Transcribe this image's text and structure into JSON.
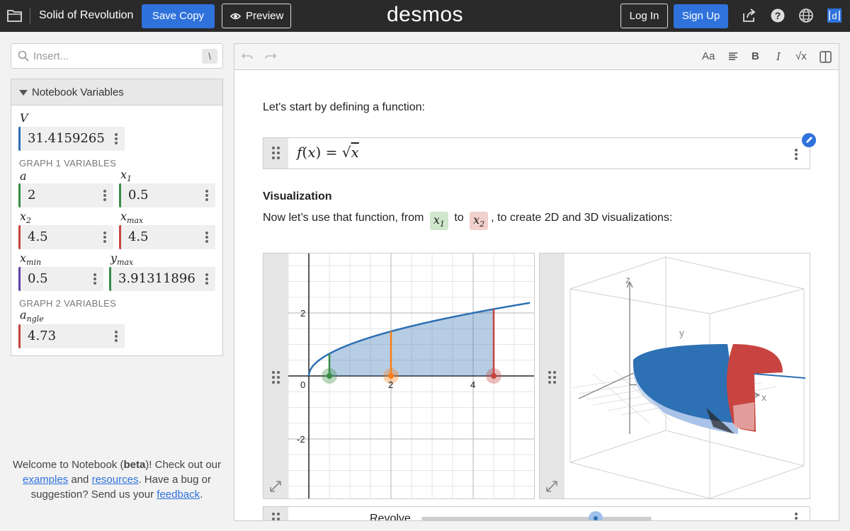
{
  "topbar": {
    "doc_title": "Solid of Revolution",
    "save_copy": "Save Copy",
    "preview": "Preview",
    "brand": "desmos",
    "login": "Log In",
    "signup": "Sign Up",
    "icons": [
      "folder-icon",
      "share-icon",
      "help-icon",
      "language-icon",
      "desmos-logo-icon"
    ]
  },
  "search": {
    "placeholder": "Insert...",
    "shortcut": "\\"
  },
  "variables": {
    "header": "Notebook Variables",
    "V": {
      "label": "V",
      "value": "31.41592654"
    },
    "graph1_header": "GRAPH 1 VARIABLES",
    "a": {
      "value": "2"
    },
    "x1": {
      "value": "0.5"
    },
    "x2": {
      "value": "4.5"
    },
    "xmax": {
      "value": "4.5"
    },
    "xmin": {
      "value": "0.5"
    },
    "ymax": {
      "value": "3.913118961"
    },
    "graph2_header": "GRAPH 2 VARIABLES",
    "angle": {
      "value": "4.73"
    }
  },
  "welcome": {
    "t1": "Welcome to Notebook (",
    "beta": "beta",
    "t2": ")! Check out our ",
    "examples": "examples",
    "t3": " and ",
    "resources": "resources",
    "t4": ". Have a bug or suggestion? Send us your ",
    "feedback": "feedback",
    "t5": "."
  },
  "notebook": {
    "intro": "Let's start by defining a function:",
    "function_latex": "f(x) = √x",
    "vis_heading": "Visualization",
    "vis_text_1": "Now let’s use that function, from",
    "vis_text_to": "to",
    "vis_text_2": ", to create 2D and 3D visualizations:",
    "slider_label": "Revolve"
  },
  "graph2d": {
    "x_ticks": [
      "0",
      "2",
      "4"
    ],
    "y_ticks": [
      "2",
      "-2"
    ]
  },
  "graph3d": {
    "axis_labels": [
      "z",
      "y",
      "x"
    ]
  },
  "colors": {
    "accent": "#2f72dc",
    "curve": "#2d70b3",
    "green": "#388c46",
    "orange": "#fa7e19",
    "red": "#c74440",
    "purple": "#6042a6"
  }
}
